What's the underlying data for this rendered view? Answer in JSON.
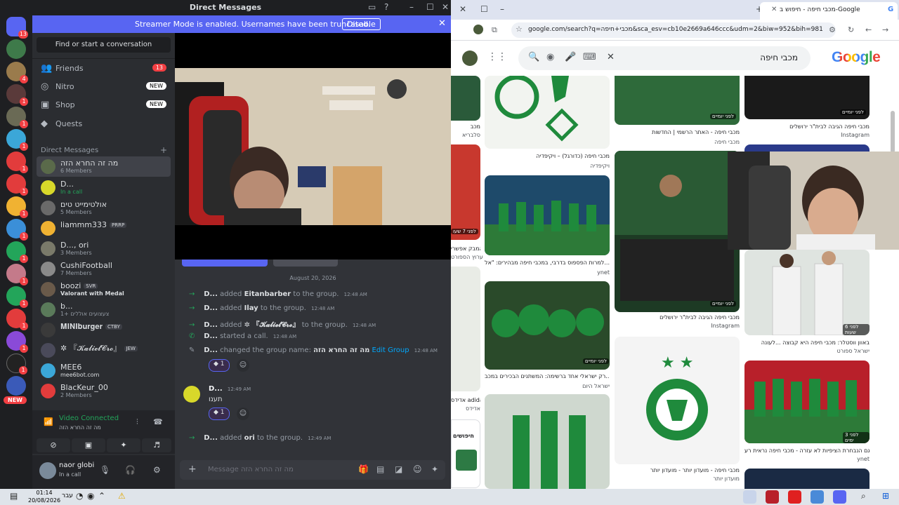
{
  "discord": {
    "window_title": "Direct Messages",
    "streamer_banner": "Streamer Mode is enabled. Usernames have been truncated.",
    "disable_label": "Disable",
    "find_placeholder": "Find or start a conversation",
    "nav": [
      {
        "label": "Friends",
        "badge": "13"
      },
      {
        "label": "Nitro",
        "badge": "NEW"
      },
      {
        "label": "Shop",
        "badge": "NEW"
      },
      {
        "label": "Quests",
        "badge": ""
      }
    ],
    "dm_header": "Direct Messages",
    "dms": [
      {
        "name": "מה זה החרא הזה",
        "sub": "6 Members",
        "tag": ""
      },
      {
        "name": "D...",
        "sub": "In a call",
        "tag": ""
      },
      {
        "name": "אולטימייט טים",
        "sub": "5 Members",
        "tag": ""
      },
      {
        "name": "liammm333",
        "sub": "",
        "tag": "PRRP"
      },
      {
        "name": "D..., ori",
        "sub": "3 Members",
        "tag": ""
      },
      {
        "name": "CushiFootball",
        "sub": "7 Members",
        "tag": ""
      },
      {
        "name": "boozi",
        "sub": "Valorant with Medal",
        "tag": "SVR"
      },
      {
        "name": "b...",
        "sub": "צעצועים אוללים +1",
        "tag": ""
      },
      {
        "name": "𝐌𝐈𝐍𝐈𝐛𝐮𝐫𝐠𝐞𝐫",
        "sub": "",
        "tag": "CTBY"
      },
      {
        "name": "✲ 『𝓚𝓪𝓵𝓲𝓮𝓵𝓒𝓻𝓸』",
        "sub": "",
        "tag": "JEW"
      },
      {
        "name": "MEE6",
        "sub": "mee6bot.com",
        "tag": ""
      },
      {
        "name": "BlacKeur_00",
        "sub": "2 Members",
        "tag": ""
      }
    ],
    "voice": {
      "status": "Video Connected",
      "channel": "מה זה החרא הזה"
    },
    "user": {
      "name": "naor globi",
      "status": "In a call"
    },
    "date_separator": "August 20, 2026",
    "messages": [
      {
        "actor": "D...",
        "action": "added",
        "target": "Eitanbarber",
        "suffix": "to the group.",
        "time": "12:48 AM"
      },
      {
        "actor": "D...",
        "action": "added",
        "target": "Ilay",
        "suffix": "to the group.",
        "time": "12:48 AM"
      },
      {
        "actor": "D...",
        "action": "added",
        "target": "✲ 『𝓚𝓪𝓵𝓲𝓮𝓵𝓒𝓻𝓸』",
        "suffix": "to the group.",
        "time": "12:48 AM"
      },
      {
        "actor": "D...",
        "action": "started a call.",
        "target": "",
        "suffix": "",
        "time": "12:48 AM"
      },
      {
        "actor": "D...",
        "action": "changed the group name:",
        "target": "מה זה החרא הזה",
        "suffix": "Edit Group",
        "time": "12:48 AM"
      },
      {
        "actor": "D...",
        "action": "added",
        "target": "ori",
        "suffix": "to the group.",
        "time": "12:49 AM"
      }
    ],
    "chat_message": {
      "author": "D...",
      "time": "12:49 AM",
      "text": "תענו"
    },
    "reaction_count": "1",
    "composer_placeholder": "Message מה זה החרא הזה"
  },
  "chrome": {
    "tab_title": "מכבי חיפה - חיפוש ב-Google",
    "url": "google.com/search?q=מכבי+חיפה&sca_esv=cb10e2669a646ccc&udm=2&biw=952&bih=981&sxsr...",
    "query": "מכבי חיפה",
    "logo": "Google",
    "results": [
      {
        "caption": "מכבי חיפה (כדורגל) – ויקיפדיה",
        "source": "ויקיפדיה"
      },
      {
        "caption": "מכבי חיפה - האתר הרשמי | החדשות",
        "source": "מכבי חיפה"
      },
      {
        "caption": "מכבי חיפה הגיבה לבית\"ר ירושלים",
        "source": "Instagram"
      },
      {
        "caption": "למרות הפספוס בדרבי, במכבי חיפה מבהירים: \"אל...",
        "source": "ynet"
      },
      {
        "caption": "מכבי חיפה הגיבה לבית\"ר ירושלים",
        "source": "Instagram"
      },
      {
        "caption": "באוון ווסטלר: מכבי חיפה היא קבוצה ...לעונה",
        "source": "ישראל ספורט"
      },
      {
        "caption": "רק ישראלי אחד ברשימה: המשתנים הבכירים במכב...",
        "source": "ישראל היום"
      },
      {
        "caption": "מכבי חיפה - מועדון יותר - מועדון יותר",
        "source": "מועדון יותר"
      },
      {
        "caption": "גם הנבחרת הציפיות לא עזרה - מכבי חיפה נראית רע...",
        "source": "ynet"
      },
      {
        "caption": "מכב",
        "source": "סלבריא"
      },
      {
        "caption": "קאמבק אפשרי",
        "source": "ערוץ הספורט"
      },
      {
        "caption": "אדידס adidas",
        "source": "אדידס"
      }
    ],
    "timestamps": [
      "לפני יומיים",
      "לפני יומיים",
      "לפני יומיים",
      "לפני 6 שעות",
      "לפני 7 שעו",
      "לפני יומיים",
      "לפני 3 ימים"
    ],
    "side_label": "חיפושים"
  },
  "taskbar": {
    "time": "01:14",
    "date": "20/08/2026",
    "lang": "עבר"
  },
  "colors": {
    "discord_accent": "#5865f2",
    "green": "#23a55a",
    "maccabi_green": "#1f8a3c",
    "danger": "#f23f43"
  }
}
